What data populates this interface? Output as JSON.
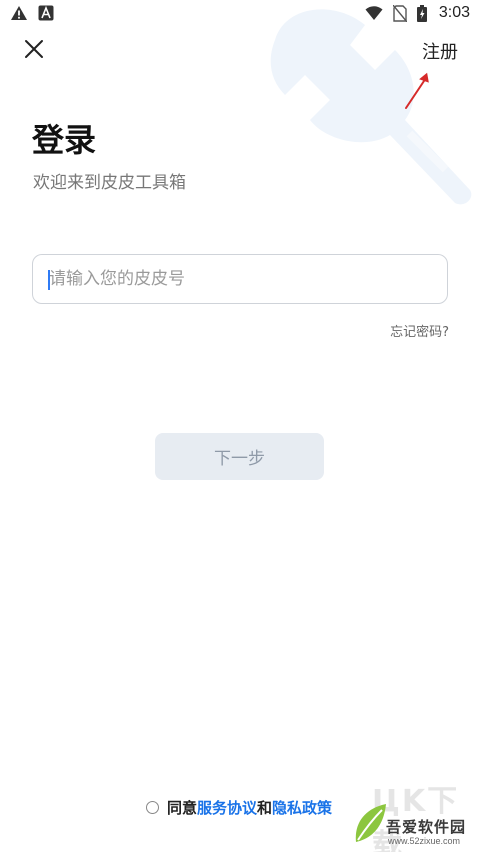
{
  "status_bar": {
    "time": "3:03",
    "left_icons": [
      "warning-icon",
      "app-a-icon"
    ],
    "right_icons": [
      "wifi-icon",
      "no-sim-icon",
      "battery-icon"
    ]
  },
  "header": {
    "close_icon": "close-icon",
    "register_label": "注册"
  },
  "login": {
    "title": "登录",
    "subtitle": "欢迎来到皮皮工具箱",
    "account_placeholder": "请输入您的皮皮号",
    "forgot_label": "忘记密码?",
    "next_label": "下一步"
  },
  "agreement": {
    "prefix": "同意",
    "service_link": "服务协议",
    "joiner": "和",
    "privacy_link": "隐私政策"
  },
  "watermark": {
    "ghost_text": "ЦK下载",
    "brand": "吾爱软件园",
    "url": "www.52zixue.com"
  },
  "colors": {
    "accent_link": "#1a73e8",
    "caret": "#2f7bf5",
    "button_bg": "#e7ecf2",
    "annotation_arrow": "#d62a2a"
  }
}
